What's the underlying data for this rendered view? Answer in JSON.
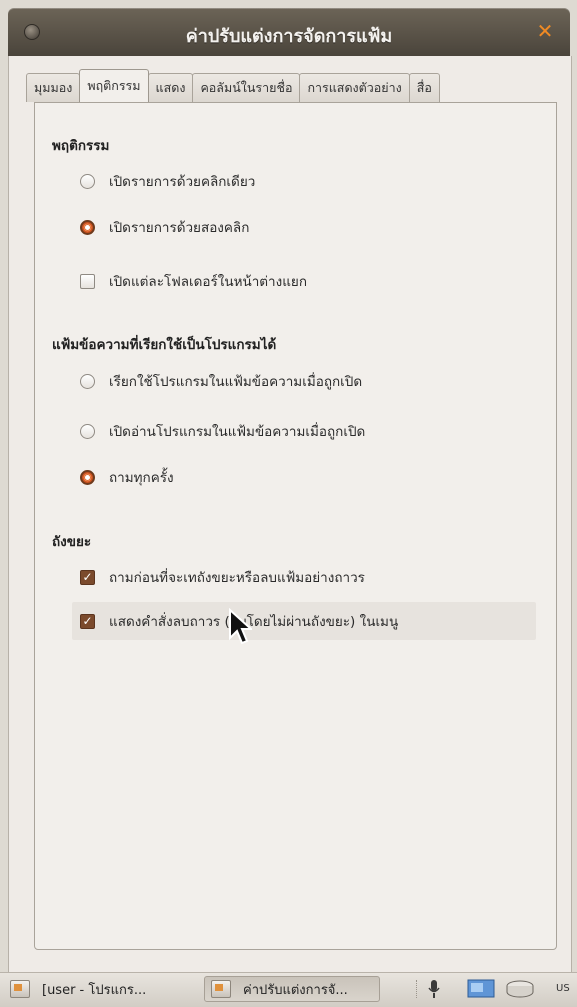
{
  "window": {
    "title": "ค่าปรับแต่งการจัดการแฟ้ม",
    "close_glyph": "✕"
  },
  "tabs": [
    {
      "label": "มุมมอง",
      "active": false
    },
    {
      "label": "พฤติกรรม",
      "active": true
    },
    {
      "label": "แสดง",
      "active": false
    },
    {
      "label": "คอลัมน์ในรายชื่อ",
      "active": false
    },
    {
      "label": "การแสดงตัวอย่าง",
      "active": false
    },
    {
      "label": "สื่อ",
      "active": false
    }
  ],
  "behavior": {
    "title": "พฤติกรรม",
    "options": [
      {
        "label": "เปิดรายการด้วยคลิกเดียว",
        "checked": false
      },
      {
        "label": "เปิดรายการด้วยสองคลิก",
        "checked": true
      }
    ],
    "separate_window": {
      "label": "เปิดแต่ละโฟลเดอร์ในหน้าต่างแยก",
      "checked": false
    }
  },
  "executable": {
    "title": "แฟ้มข้อความที่เรียกใช้เป็นโปรแกรมได้",
    "options": [
      {
        "label": "เรียกใช้โปรแกรมในแฟ้มข้อความเมื่อถูกเปิด",
        "checked": false
      },
      {
        "label": "เปิดอ่านโปรแกรมในแฟ้มข้อความเมื่อถูกเปิด",
        "checked": false
      },
      {
        "label": "ถามทุกครั้ง",
        "checked": true
      }
    ]
  },
  "trash": {
    "title": "ถังขยะ",
    "options": [
      {
        "label": "ถามก่อนที่จะเทถังขยะหรือลบแฟ้มอย่างถาวร",
        "checked": true
      },
      {
        "label": "แสดงคำสั่งลบถาวร (ลบโดยไม่ผ่านถังขยะ) ในเมนู",
        "checked": true
      }
    ]
  },
  "taskbar": {
    "tasks": [
      {
        "label": "[user - โปรแกร...",
        "active": false
      },
      {
        "label": "ค่าปรับแต่งการจั...",
        "active": true
      }
    ],
    "tray_text": "US"
  },
  "icons": [
    "window-menu-icon",
    "close-icon",
    "mouse-cursor-icon",
    "task-window-icon",
    "microphone-icon",
    "moon-icon",
    "display-icon",
    "drive-icon"
  ]
}
